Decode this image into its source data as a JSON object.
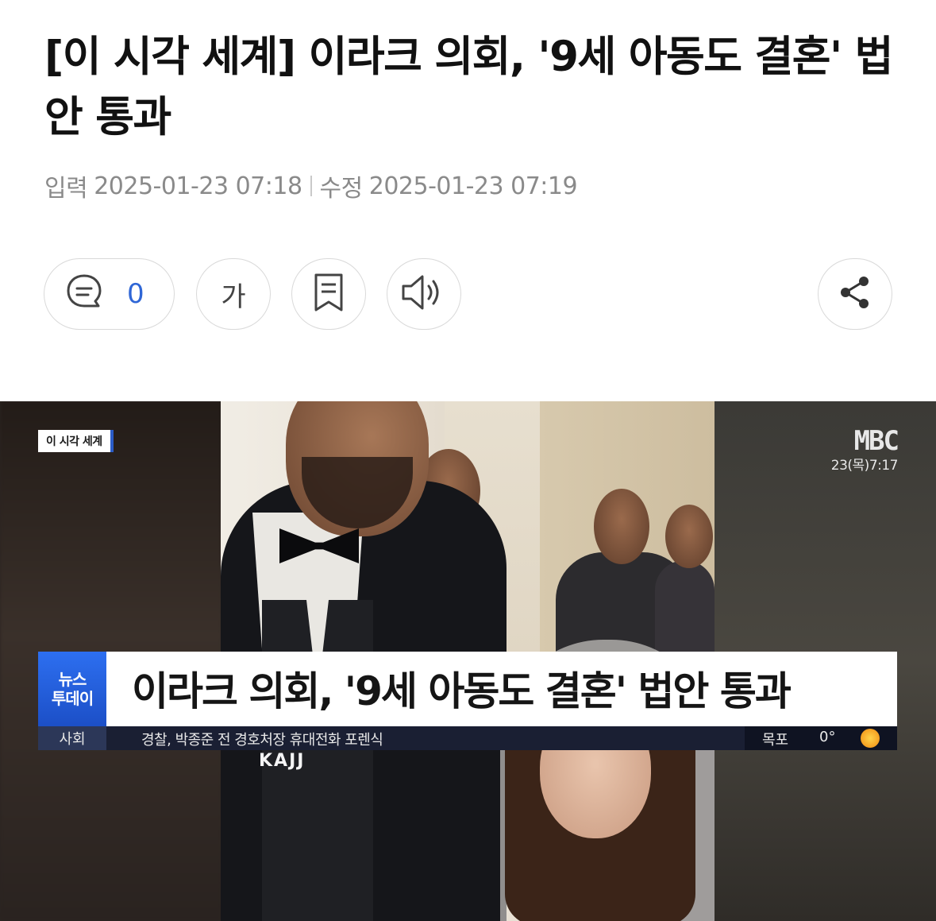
{
  "article": {
    "headline": "[이 시각 세계] 이라크 의회, '9세 아동도 결혼' 법안 통과",
    "input_label": "입력",
    "input_time": "2025-01-23 07:18",
    "edit_label": "수정",
    "edit_time": "2025-01-23 07:19"
  },
  "toolbar": {
    "comment_count": "0",
    "font_label": "가",
    "icons": [
      "comment-icon",
      "bookmark-icon",
      "speaker-icon",
      "share-icon"
    ]
  },
  "video": {
    "corner_tag": "이 시각 세계",
    "broadcaster_logo": "MBC",
    "clock": "23(목)7:17",
    "show_badge_line1": "뉴스",
    "show_badge_line2": "투데이",
    "lower_third_title": "이라크 의회, '9세 아동도 결혼' 법안 통과",
    "ticker_category": "사회",
    "ticker_text": "경찰, 박종준 전 경호처장 휴대전화 포렌식",
    "weather_city": "목포",
    "weather_temp": "0°",
    "bottom_caption": "KAJJ"
  },
  "colors": {
    "accent_blue": "#2f66d6",
    "badge_blue": "#1c4fc7",
    "meta_gray": "#8a8a8a"
  }
}
